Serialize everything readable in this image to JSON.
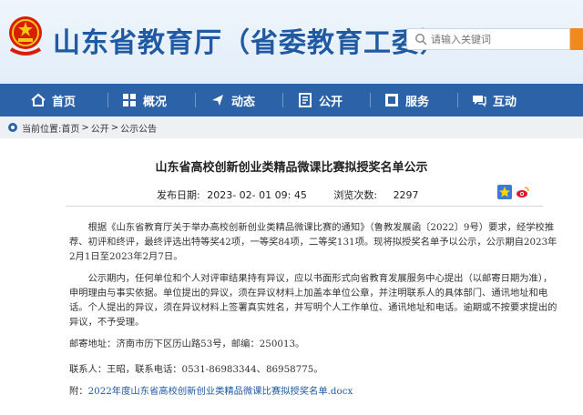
{
  "header": {
    "site_title": "山东省教育厅（省委教育工委）",
    "search_placeholder": "请输入关键词"
  },
  "nav": {
    "items": [
      {
        "label": "首页",
        "icon": "home-icon"
      },
      {
        "label": "概况",
        "icon": "overview-icon"
      },
      {
        "label": "动态",
        "icon": "news-icon"
      },
      {
        "label": "公开",
        "icon": "open-icon"
      },
      {
        "label": "服务",
        "icon": "service-icon"
      },
      {
        "label": "互动",
        "icon": "interaction-icon"
      }
    ]
  },
  "breadcrumb": {
    "prefix": "当前位置:",
    "items": [
      "首页",
      "公开",
      "公示公告"
    ],
    "separator": ">"
  },
  "article": {
    "title": "山东省高校创新创业类精品微课比赛拟授奖名单公示",
    "publish_label": "发布日期:",
    "publish_date": "2023- 02- 01 09: 45",
    "views_label": "浏览次数:",
    "views": "2297",
    "paragraph1": "根据《山东省教育厅关于举办高校创新创业类精品微课比赛的通知》（鲁教发展函〔2022〕9号）要求，经学校推荐、初评和终评，最终评选出特等奖42项，一等奖84项，二等奖131项。现将拟授奖名单予以公示，公示期自2023年2月1日至2023年2月7日。",
    "paragraph2": "公示期内，任何单位和个人对评审结果持有异议，应以书面形式向省教育发展服务中心提出（以邮寄日期为准），申明理由与事实依据。单位提出的异议，须在异议材料上加盖本单位公章，并注明联系人的具体部门、通讯地址和电话。个人提出的异议，须在异议材料上签署真实姓名，并写明个人工作单位、通讯地址和电话。逾期或不按要求提出的异议，不予受理。",
    "mail_address": "邮寄地址：济南市历下区历山路53号，邮编：250013。",
    "contact": "联系人：王昭，联系电话：0531-86983344、86958775。",
    "attachment_label": "附：",
    "attachment_link": "2022年度山东省高校创新创业类精品微课比赛拟授奖名单.docx"
  },
  "colors": {
    "brand_blue": "#1f5aa3",
    "nav_bg": "#2c63a8",
    "search_button": "#f08a1c"
  }
}
